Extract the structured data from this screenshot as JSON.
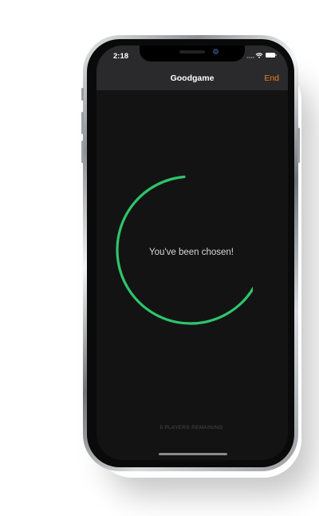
{
  "status_bar": {
    "time": "2:18",
    "signal_icon": "signal-dots-icon",
    "wifi_icon": "wifi-icon",
    "battery_icon": "battery-icon"
  },
  "nav": {
    "title": "Goodgame",
    "end_label": "End"
  },
  "main": {
    "countdown_progress": 0.78,
    "message": "You've been chosen!",
    "players_remaining": "6 PLAYERS REMAINING"
  },
  "colors": {
    "accent": "#f07c24",
    "ring": "#2ec46a",
    "background": "#131314",
    "nav_background": "#2a2a2c"
  }
}
